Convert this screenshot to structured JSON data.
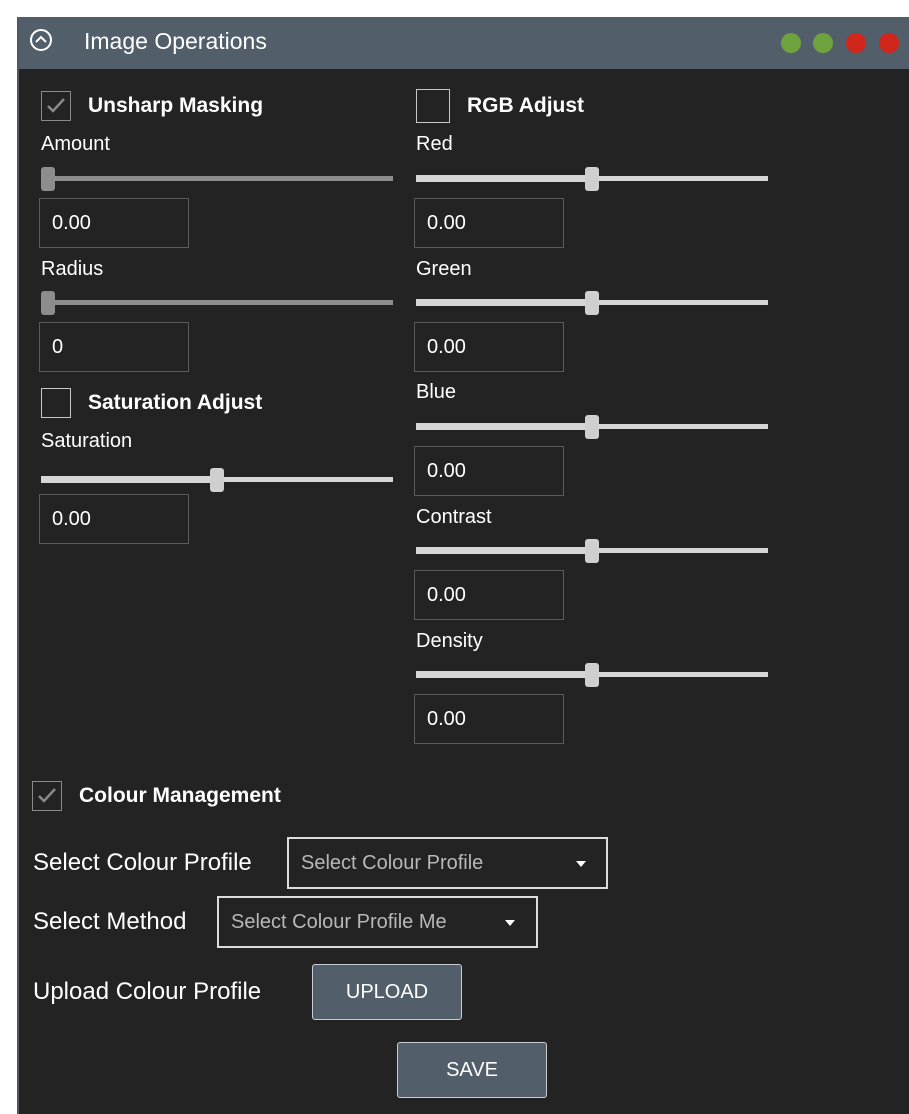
{
  "panel": {
    "title": "Image Operations",
    "status_dots": [
      "#6da23d",
      "#6da23d",
      "#d0261c",
      "#d0261c"
    ]
  },
  "unsharp": {
    "label": "Unsharp Masking",
    "checked": true,
    "amount": {
      "label": "Amount",
      "value": "0.00",
      "level": 0.0
    },
    "radius": {
      "label": "Radius",
      "value": "0",
      "level": 0.0
    }
  },
  "saturation": {
    "label": "Saturation Adjust",
    "checked": false,
    "saturation": {
      "label": "Saturation",
      "value": "0.00",
      "level": 0.5
    }
  },
  "rgb": {
    "label": "RGB Adjust",
    "checked": false,
    "red": {
      "label": "Red",
      "value": "0.00",
      "level": 0.5
    },
    "green": {
      "label": "Green",
      "value": "0.00",
      "level": 0.5
    },
    "blue": {
      "label": "Blue",
      "value": "0.00",
      "level": 0.5
    },
    "contrast": {
      "label": "Contrast",
      "value": "0.00",
      "level": 0.5
    },
    "density": {
      "label": "Density",
      "value": "0.00",
      "level": 0.5
    }
  },
  "colour": {
    "label": "Colour Management",
    "checked": true,
    "profile_label": "Select Colour Profile",
    "profile_value": "Select Colour Profile",
    "method_label": "Select Method",
    "method_value": "Select Colour Profile Me",
    "upload_label": "Upload Colour Profile",
    "upload_button": "UPLOAD",
    "save_button": "SAVE"
  },
  "icons": {
    "collapse": "chevron-up-circle-icon",
    "check": "check-icon",
    "dropdown": "caret-down-icon"
  }
}
